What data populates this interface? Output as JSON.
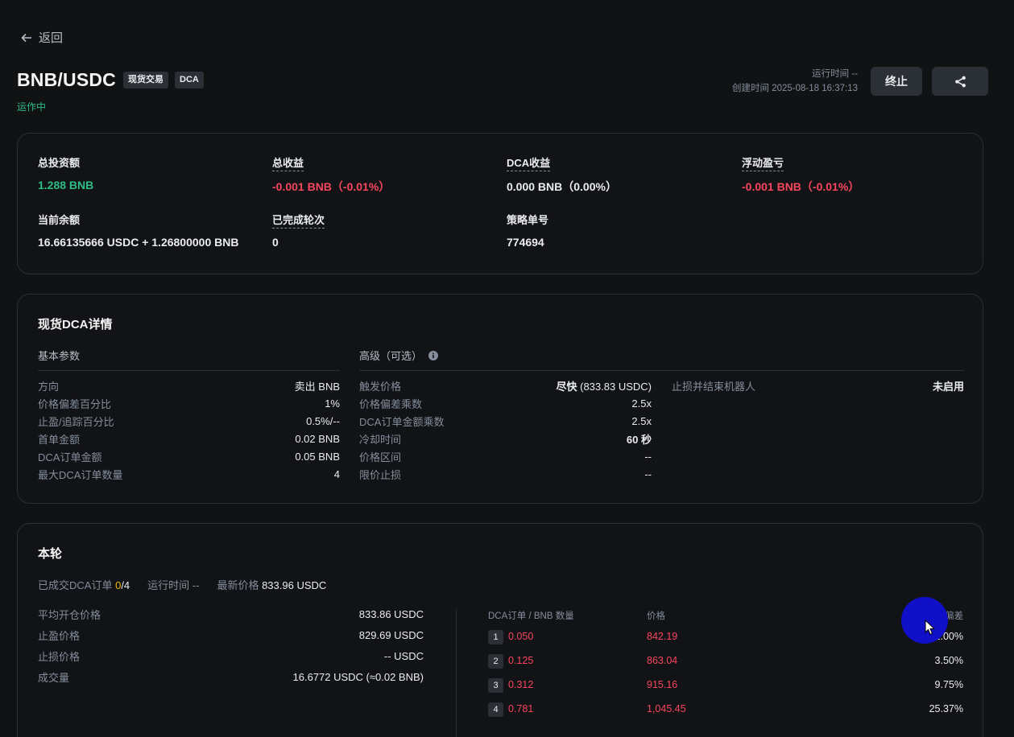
{
  "nav": {
    "back_label": "返回"
  },
  "header": {
    "pair": "BNB/USDC",
    "tags": [
      "现货交易",
      "DCA"
    ],
    "status": "运作中",
    "run_time": "运行时间 --",
    "created": "创建时间 2025-08-18 16:37:13",
    "stop_label": "终止"
  },
  "summary": {
    "total_invest": {
      "label": "总投资额",
      "value": "1.288  BNB"
    },
    "total_profit": {
      "label": "总收益",
      "value": "-0.001  BNB（-0.01%）"
    },
    "dca_profit": {
      "label": "DCA收益",
      "value": "0.000  BNB（0.00%）"
    },
    "floating_pnl": {
      "label": "浮动盈亏",
      "value": "-0.001  BNB（-0.01%）"
    },
    "balance": {
      "label": "当前余额",
      "value": "16.66135666 USDC + 1.26800000 BNB"
    },
    "rounds": {
      "label": "已完成轮次",
      "value": "0"
    },
    "strategy_id": {
      "label": "策略单号",
      "value": "774694"
    }
  },
  "details": {
    "title": "现货DCA详情",
    "basic_title": "基本参数",
    "advanced_title": "高级（可选）",
    "basic": [
      {
        "k": "方向",
        "v": "卖出 BNB"
      },
      {
        "k": "价格偏差百分比",
        "v": "1%"
      },
      {
        "k": "止盈/追踪百分比",
        "v": "0.5%/--"
      },
      {
        "k": "首单金额",
        "v": "0.02 BNB"
      },
      {
        "k": "DCA订单金额",
        "v": "0.05 BNB"
      },
      {
        "k": "最大DCA订单数量",
        "v": "4"
      }
    ],
    "advanced": [
      {
        "k": "触发价格",
        "v_bold": "尽快",
        "v": " (833.83 USDC)"
      },
      {
        "k": "价格偏差乘数",
        "v_bold": "",
        "v": "2.5x"
      },
      {
        "k": "DCA订单金额乘数",
        "v_bold": "",
        "v": "2.5x"
      },
      {
        "k": "冷却时间",
        "v_bold": "60 秒",
        "v": ""
      },
      {
        "k": "价格区间",
        "v_bold": "",
        "v": "--"
      },
      {
        "k": "限价止损",
        "v_bold": "",
        "v": "--"
      }
    ],
    "stoploss": {
      "k": "止损并结束机器人",
      "v": "未启用"
    }
  },
  "round": {
    "title": "本轮",
    "filled_label": "已成交DCA订单",
    "filled_done": "0",
    "filled_total": "/4",
    "run_time": "运行时间 --",
    "last_price_label": "最新价格",
    "last_price": "833.96 USDC",
    "left": [
      {
        "k": "平均开仓价格",
        "v": "833.86 USDC"
      },
      {
        "k": "止盈价格",
        "v": "829.69 USDC"
      },
      {
        "k": "止损价格",
        "v": "-- USDC"
      },
      {
        "k": "成交量",
        "v": "16.6772 USDC (≈0.02 BNB)"
      }
    ],
    "table_headers": {
      "qty": "DCA订单 / BNB 数量",
      "price": "价格",
      "dev": "价格偏差"
    },
    "orders": [
      {
        "n": "1",
        "qty": "0.050",
        "price": "842.19",
        "dev": "1.00%"
      },
      {
        "n": "2",
        "qty": "0.125",
        "price": "863.04",
        "dev": "3.50%"
      },
      {
        "n": "3",
        "qty": "0.312",
        "price": "915.16",
        "dev": "9.75%"
      },
      {
        "n": "4",
        "qty": "0.781",
        "price": "1,045.45",
        "dev": "25.37%"
      }
    ]
  },
  "colors": {
    "up": "#2ebd85",
    "down": "#f6465d",
    "accent": "#f0b90b",
    "bg": "#111214"
  }
}
